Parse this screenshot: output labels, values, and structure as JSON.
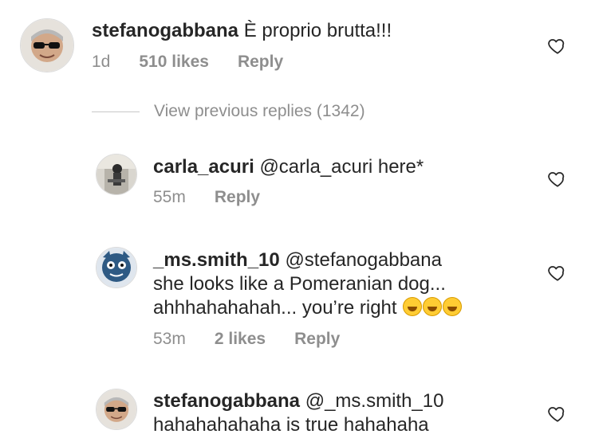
{
  "comments": [
    {
      "username": "stefanogabbana",
      "text": "È proprio brutta!!!",
      "time": "1d",
      "likes": "510 likes",
      "reply": "Reply"
    },
    {
      "username": "carla_acuri",
      "text": "@carla_acuri here*",
      "time": "55m",
      "reply": "Reply"
    },
    {
      "username": "_ms.smith_10",
      "line1": "@stefanogabbana",
      "line2": "she looks like a Pomeranian dog...",
      "line3": "ahhhahahahah... you’re right",
      "time": "53m",
      "likes": "2 likes",
      "reply": "Reply"
    },
    {
      "username": "stefanogabbana",
      "line1": "@_ms.smith_10",
      "line2": "hahahahahaha is true hahahaha"
    }
  ],
  "view_previous": "View previous replies (1342)",
  "icons": {
    "like": "heart-icon",
    "emoji": "rolling-laughing-emoji"
  }
}
